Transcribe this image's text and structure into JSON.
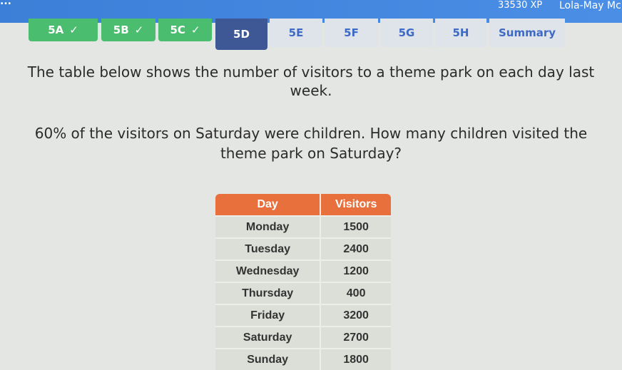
{
  "header": {
    "logo": "...",
    "xp": "33530 XP",
    "user": "Lola-May Mc"
  },
  "tabs": [
    {
      "label": "5A",
      "status": "done"
    },
    {
      "label": "5B",
      "status": "done"
    },
    {
      "label": "5C",
      "status": "done"
    },
    {
      "label": "5D",
      "status": "current"
    },
    {
      "label": "5E",
      "status": "todo"
    },
    {
      "label": "5F",
      "status": "todo"
    },
    {
      "label": "5G",
      "status": "todo"
    },
    {
      "label": "5H",
      "status": "todo"
    },
    {
      "label": "Summary",
      "status": "todo"
    }
  ],
  "check": "✓",
  "question": {
    "line1": "The table below shows the number of visitors to a theme park on each day last",
    "line2": "week.",
    "line3": "60% of the visitors on Saturday were children. How many children visited the",
    "line4": "theme park on Saturday?"
  },
  "table": {
    "headers": [
      "Day",
      "Visitors"
    ],
    "rows": [
      [
        "Monday",
        "1500"
      ],
      [
        "Tuesday",
        "2400"
      ],
      [
        "Wednesday",
        "1200"
      ],
      [
        "Thursday",
        "400"
      ],
      [
        "Friday",
        "3200"
      ],
      [
        "Saturday",
        "2700"
      ],
      [
        "Sunday",
        "1800"
      ]
    ]
  }
}
